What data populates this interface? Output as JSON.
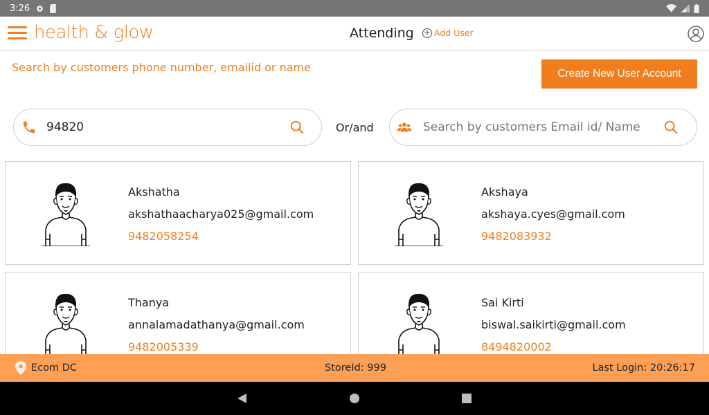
{
  "status_bar": {
    "time": "3:26"
  },
  "app": {
    "brand": "health & glow",
    "title": "Attending",
    "add_user_label": "Add User"
  },
  "search": {
    "hint": "Search by customers phone number, emailid or name",
    "create_button_label": "Create New User Account",
    "phone_value": "94820",
    "or_and_label": "Or/and",
    "email_placeholder": "Search by customers Email id/ Name"
  },
  "customers": [
    {
      "name": "Akshatha",
      "email": "akshathaacharya025@gmail.com",
      "phone": "9482058254"
    },
    {
      "name": "Akshaya",
      "email": "akshaya.cyes@gmail.com",
      "phone": "9482083932"
    },
    {
      "name": "Thanya",
      "email": "annalamadathanya@gmail.com",
      "phone": "9482005339"
    },
    {
      "name": "Sai Kirti",
      "email": "biswal.saikirti@gmail.com",
      "phone": "8494820002"
    }
  ],
  "footer": {
    "location": "Ecom DC",
    "store_id": "StoreId: 999",
    "last_login": "Last Login: 20:26:17"
  },
  "colors": {
    "accent": "#f07e1e",
    "footer_bg": "#fda055"
  },
  "icons": [
    "menu-icon",
    "plus-circle-icon",
    "user-circle-icon",
    "phone-icon",
    "search-icon",
    "users-icon",
    "location-pin-icon",
    "avatar-icon",
    "back-icon",
    "home-icon",
    "recents-icon"
  ]
}
